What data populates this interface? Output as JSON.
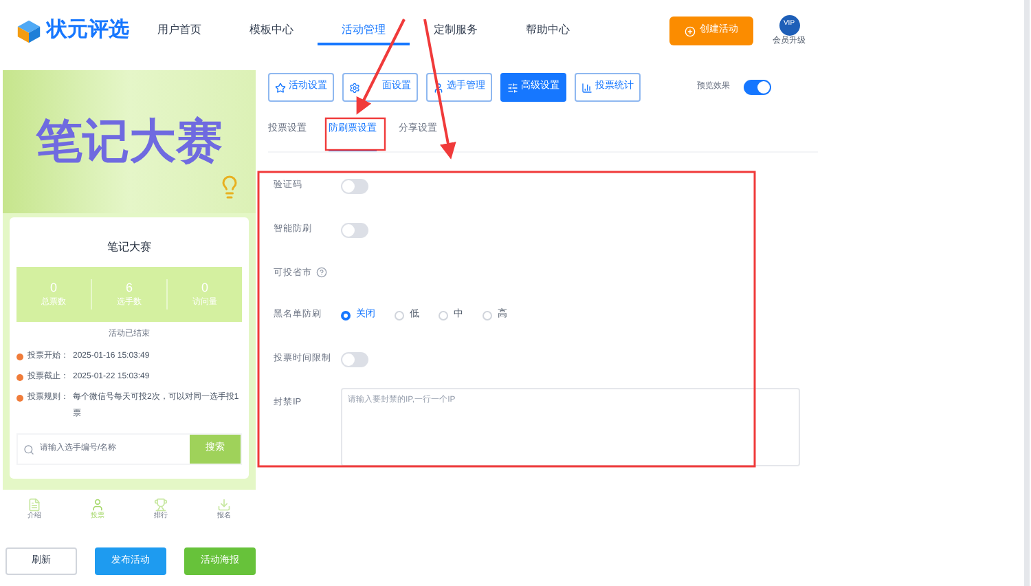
{
  "logo": {
    "text": "状元评选"
  },
  "nav": [
    {
      "label": "用户首页",
      "selected": false
    },
    {
      "label": "模板中心",
      "selected": false
    },
    {
      "label": "活动管理",
      "selected": true
    },
    {
      "label": "定制服务",
      "selected": false
    },
    {
      "label": "帮助中心",
      "selected": false
    }
  ],
  "create_button": "创建活动",
  "vip": {
    "badge": "VIP",
    "label": "会员升级"
  },
  "preview": {
    "banner_title": "笔记大赛",
    "card_title": "笔记大赛",
    "stats": [
      {
        "value": "0",
        "label": "总票数"
      },
      {
        "value": "6",
        "label": "选手数"
      },
      {
        "value": "0",
        "label": "访问量"
      }
    ],
    "status": "活动已结束",
    "info": [
      {
        "label": "投票开始：",
        "value": "2025-01-16 15:03:49"
      },
      {
        "label": "投票截止：",
        "value": "2025-01-22 15:03:49"
      },
      {
        "label": "投票规则：",
        "value": "每个微信号每天可投2次，可以对同一选手投1票"
      }
    ],
    "search": {
      "placeholder": "请输入选手编号/名称",
      "button": "搜索"
    },
    "bottom_nav": [
      {
        "label": "介绍",
        "selected": false,
        "kind": "intro"
      },
      {
        "label": "投票",
        "selected": true,
        "kind": "vote"
      },
      {
        "label": "排行",
        "selected": false,
        "kind": "rank"
      },
      {
        "label": "报名",
        "selected": false,
        "kind": "signup"
      }
    ]
  },
  "actions": [
    {
      "label": "刷新",
      "kind": "plain"
    },
    {
      "label": "发布活动",
      "kind": "primary"
    },
    {
      "label": "活动海报",
      "kind": "success"
    }
  ],
  "toolbar": {
    "buttons": [
      {
        "label": "活动设置",
        "selected": false,
        "kind": "star"
      },
      {
        "label": "面设置",
        "selected": false,
        "kind": "gear"
      },
      {
        "label": "选手管理",
        "selected": false,
        "kind": "user"
      },
      {
        "label": "高级设置",
        "selected": true,
        "kind": "advanced"
      },
      {
        "label": "投票统计",
        "selected": false,
        "kind": "chart"
      }
    ],
    "preview_toggle": {
      "label": "预览效果",
      "on": true
    }
  },
  "subtabs": [
    {
      "label": "投票设置",
      "selected": false
    },
    {
      "label": "防刷票设置",
      "selected": true
    },
    {
      "label": "分享设置",
      "selected": false
    }
  ],
  "form": [
    {
      "kind": "toggle",
      "label": "验证码",
      "on": false
    },
    {
      "kind": "toggle",
      "label": "智能防刷",
      "on": false
    },
    {
      "kind": "help",
      "label": "可投省市"
    },
    {
      "kind": "radio",
      "label": "黑名单防刷",
      "options": [
        {
          "label": "关闭",
          "selected": true
        },
        {
          "label": "低",
          "selected": false
        },
        {
          "label": "中",
          "selected": false
        },
        {
          "label": "高",
          "selected": false
        }
      ]
    },
    {
      "kind": "toggle",
      "label": "投票时间限制",
      "on": false
    },
    {
      "kind": "textarea",
      "label": "封禁IP",
      "placeholder": "请输入要封禁的IP,一行一个IP"
    }
  ]
}
